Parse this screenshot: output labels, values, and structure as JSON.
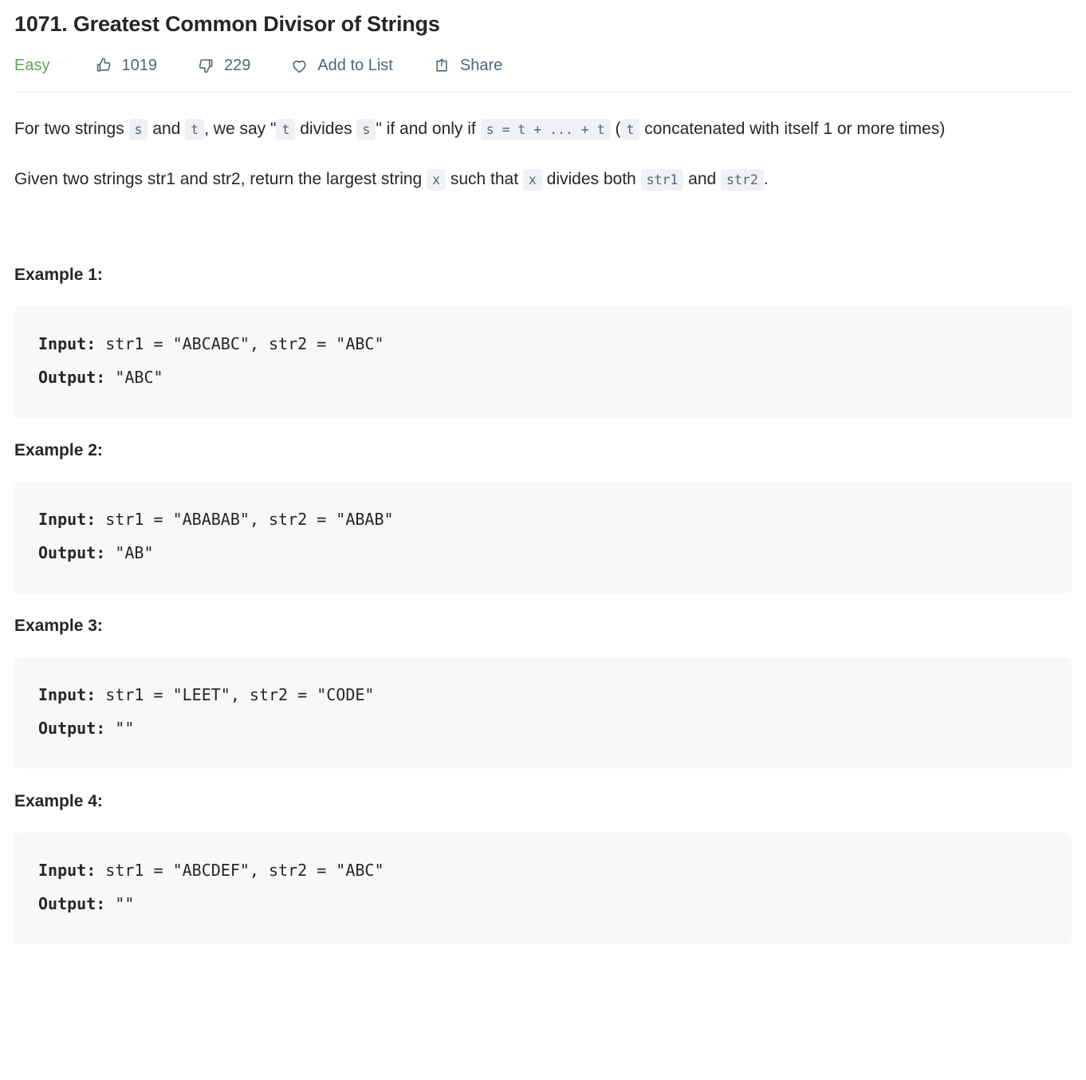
{
  "problem": {
    "title": "1071. Greatest Common Divisor of Strings",
    "difficulty": "Easy",
    "likes": "1019",
    "dislikes": "229",
    "add_to_list_label": "Add to List",
    "share_label": "Share"
  },
  "icons": {
    "thumbs_up": "thumbs-up-icon",
    "thumbs_down": "thumbs-down-icon",
    "heart": "heart-icon",
    "share": "share-icon"
  },
  "colors": {
    "easy_green": "#5ba65b",
    "meta_text": "#546575",
    "body_text": "#262626",
    "inline_code_bg": "#eff1f4",
    "inline_code_text": "#5b6472",
    "code_block_bg": "#f7f8fa",
    "divider": "#e7e8ea"
  },
  "description": {
    "p1": {
      "t1": "For two strings ",
      "c1": "s",
      "t2": " and ",
      "c2": "t",
      "t3": ", we say \"",
      "c3": "t",
      "t4": " divides ",
      "c4": "s",
      "t5": "\" if and only if ",
      "c5": "s = t + ... + t",
      "t6": " (",
      "c6": "t",
      "t7": " concatenated with itself 1 or more times)"
    },
    "p2": {
      "t1": "Given two strings str1 and str2, return the largest string ",
      "c1": "x",
      "t2": " such that ",
      "c2": "x",
      "t3": " divides both ",
      "c3": "str1",
      "t4": " and ",
      "c4": "str2",
      "t5": "."
    }
  },
  "examples": [
    {
      "heading": "Example 1:",
      "input_label": "Input:",
      "input_value": " str1 = \"ABCABC\", str2 = \"ABC\"",
      "output_label": "Output:",
      "output_value": " \"ABC\""
    },
    {
      "heading": "Example 2:",
      "input_label": "Input:",
      "input_value": " str1 = \"ABABAB\", str2 = \"ABAB\"",
      "output_label": "Output:",
      "output_value": " \"AB\""
    },
    {
      "heading": "Example 3:",
      "input_label": "Input:",
      "input_value": " str1 = \"LEET\", str2 = \"CODE\"",
      "output_label": "Output:",
      "output_value": " \"\""
    },
    {
      "heading": "Example 4:",
      "input_label": "Input:",
      "input_value": " str1 = \"ABCDEF\", str2 = \"ABC\"",
      "output_label": "Output:",
      "output_value": " \"\""
    }
  ]
}
